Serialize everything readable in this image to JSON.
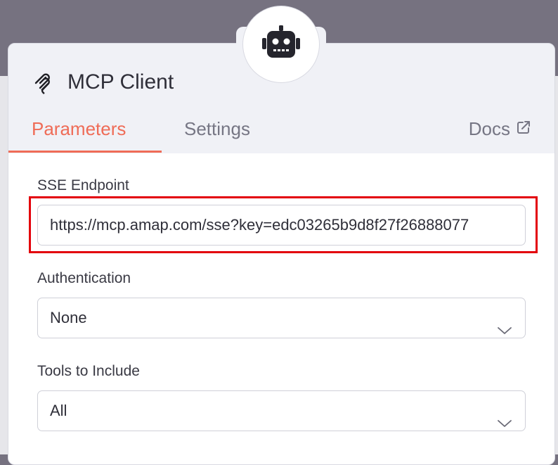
{
  "node": {
    "title": "MCP Client",
    "icon": "mcp-plug-icon",
    "badge_icon": "robot-icon"
  },
  "tabs": [
    {
      "label": "Parameters",
      "active": true
    },
    {
      "label": "Settings",
      "active": false
    },
    {
      "label": "Docs",
      "active": false,
      "icon": "external-link-icon"
    }
  ],
  "fields": {
    "sse_endpoint": {
      "label": "SSE Endpoint",
      "value": "https://mcp.amap.com/sse?key=edc03265b9d8f27f26888077"
    },
    "authentication": {
      "label": "Authentication",
      "value": "None"
    },
    "tools_to_include": {
      "label": "Tools to Include",
      "value": "All"
    }
  },
  "colors": {
    "accent": "#ef6c57",
    "highlight": "#e3000b",
    "backdrop": "#767280",
    "panel": "#f0f1f6"
  }
}
